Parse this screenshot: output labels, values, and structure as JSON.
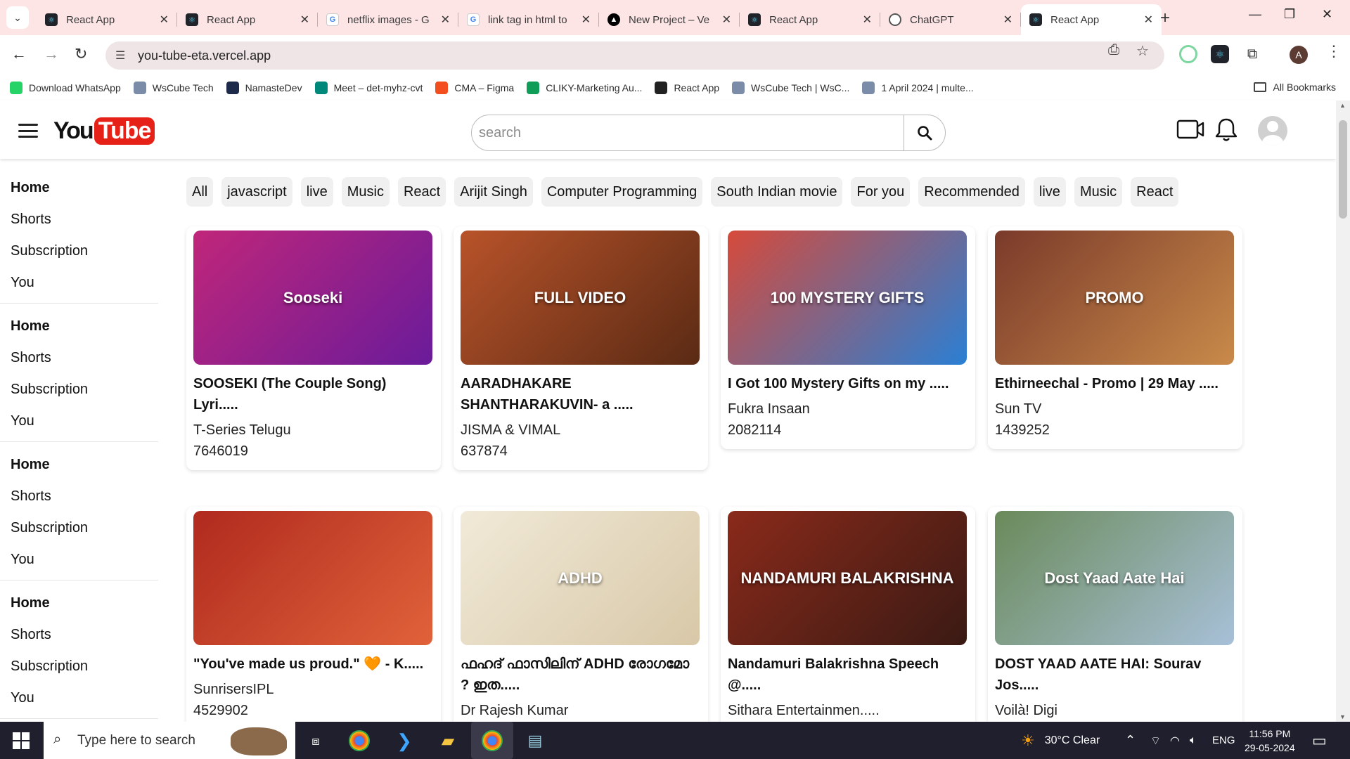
{
  "browser": {
    "tabs": [
      {
        "title": "React App",
        "favicon": "react-icon",
        "active": false
      },
      {
        "title": "React App",
        "favicon": "react-icon",
        "active": false
      },
      {
        "title": "netflix images - G",
        "favicon": "google-icon",
        "active": false
      },
      {
        "title": "link tag in html to",
        "favicon": "google-icon",
        "active": false
      },
      {
        "title": "New Project – Ve",
        "favicon": "vercel-icon",
        "active": false
      },
      {
        "title": "React App",
        "favicon": "react-icon",
        "active": false
      },
      {
        "title": "ChatGPT",
        "favicon": "chatgpt-icon",
        "active": false
      },
      {
        "title": "React App",
        "favicon": "react-icon",
        "active": true
      }
    ],
    "url": "you-tube-eta.vercel.app",
    "profile_initial": "A",
    "bookmarks": [
      {
        "label": "Download WhatsApp",
        "color": "#25d366"
      },
      {
        "label": "WsCube Tech",
        "color": "#7a8ca8"
      },
      {
        "label": "NamasteDev",
        "color": "#1e2a4a"
      },
      {
        "label": "Meet – det-myhz-cvt",
        "color": "#00897b"
      },
      {
        "label": "CMA – Figma",
        "color": "#f24e1e"
      },
      {
        "label": "CLIKY-Marketing Au...",
        "color": "#0f9d58"
      },
      {
        "label": "React App",
        "color": "#222222"
      },
      {
        "label": "WsCube Tech | WsC...",
        "color": "#7a8ca8"
      },
      {
        "label": "1 April 2024 | multe...",
        "color": "#7a8ca8"
      }
    ],
    "all_bookmarks_label": "All Bookmarks"
  },
  "app": {
    "logo": {
      "you": "You",
      "tube": "Tube"
    },
    "search": {
      "placeholder": "search",
      "value": ""
    },
    "sidebar": [
      [
        "Home",
        "Shorts",
        "Subscription",
        "You"
      ],
      [
        "Home",
        "Shorts",
        "Subscription",
        "You"
      ],
      [
        "Home",
        "Shorts",
        "Subscription",
        "You"
      ],
      [
        "Home",
        "Shorts",
        "Subscription",
        "You"
      ]
    ],
    "chips": [
      "All",
      "javascript",
      "live",
      "Music",
      "React",
      "Arijit Singh",
      "Computer Programming",
      "South Indian movie",
      "For you",
      "Recommended",
      "live",
      "Music",
      "React"
    ],
    "videos": [
      {
        "title": "SOOSEKI (The Couple Song) Lyri.....",
        "channel": "T-Series Telugu",
        "views": "7646019",
        "thumb_text": "Sooseki",
        "thumb_colors": [
          "#c0267a",
          "#6a1b9a"
        ]
      },
      {
        "title": "AARADHAKARE SHANTHARAKUVIN- a .....",
        "channel": "JISMA & VIMAL",
        "views": "637874",
        "thumb_text": "FULL VIDEO",
        "thumb_colors": [
          "#b8532a",
          "#5a2a14"
        ]
      },
      {
        "title": "I Got 100 Mystery Gifts on my .....",
        "channel": "Fukra Insaan",
        "views": "2082114",
        "thumb_text": "100 MYSTERY GIFTS",
        "thumb_colors": [
          "#d64a3a",
          "#2a7fd4"
        ]
      },
      {
        "title": "Ethirneechal - Promo | 29 May .....",
        "channel": "Sun TV",
        "views": "1439252",
        "thumb_text": "PROMO",
        "thumb_colors": [
          "#7a3a2a",
          "#c98a4a"
        ]
      },
      {
        "title": "\"You've made us proud.\" 🧡 - K.....",
        "channel": "SunrisersIPL",
        "views": "4529902",
        "thumb_text": "",
        "thumb_colors": [
          "#b02a1e",
          "#e0623a"
        ]
      },
      {
        "title": "ഫഹദ് ഫാസിലിന് ADHD രോഗമോ ? ഇത.....",
        "channel": "Dr Rajesh Kumar",
        "views": "",
        "thumb_text": "ADHD",
        "thumb_colors": [
          "#f1ead8",
          "#d8c8a8"
        ]
      },
      {
        "title": "Nandamuri Balakrishna Speech @.....",
        "channel": "Sithara Entertainmen.....",
        "views": "",
        "thumb_text": "NANDAMURI BALAKRISHNA",
        "thumb_colors": [
          "#8a2a1a",
          "#3a1a14"
        ]
      },
      {
        "title": "DOST YAAD AATE HAI: Sourav Jos.....",
        "channel": "Voilà! Digi",
        "views": "",
        "thumb_text": "Dost Yaad Aate Hai",
        "thumb_colors": [
          "#6a8a5a",
          "#a8c0d8"
        ]
      }
    ]
  },
  "taskbar": {
    "search_placeholder": "Type here to search",
    "weather": "30°C  Clear",
    "language": "ENG",
    "time": "11:56 PM",
    "date": "29-05-2024"
  }
}
